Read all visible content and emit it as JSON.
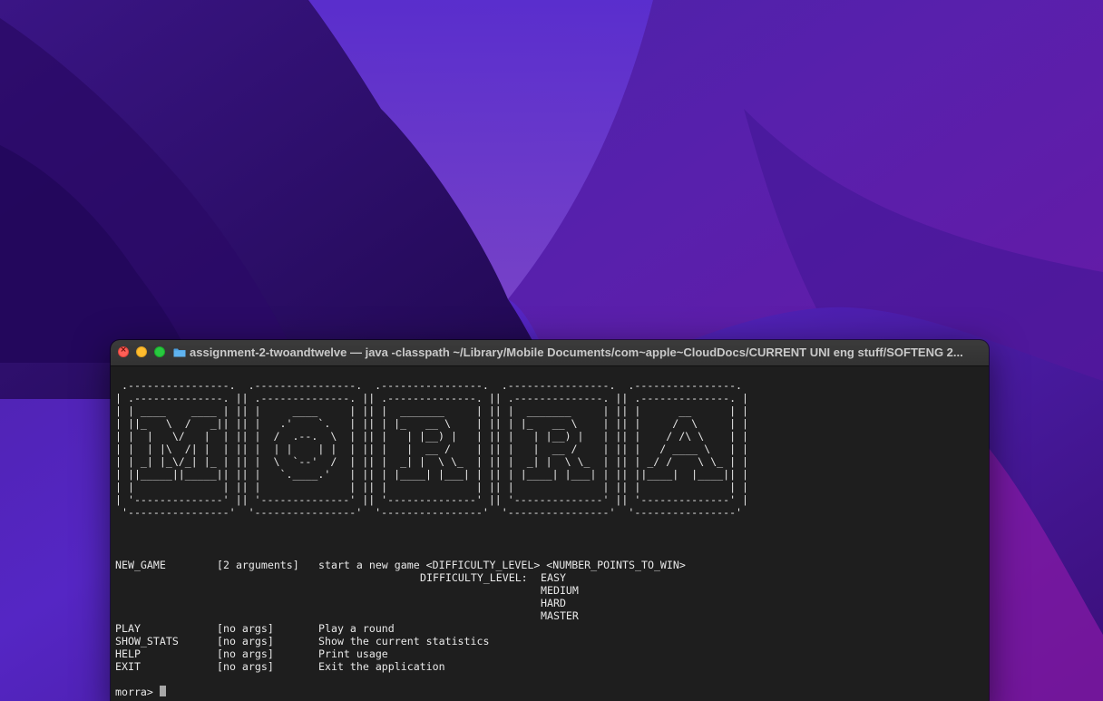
{
  "desktop": {
    "wallpaper": "macOS Monterey",
    "colors": {
      "base": "#3b0f7a",
      "light": "#6b32d8",
      "dark": "#1e0845",
      "accent": "#c44cc9"
    }
  },
  "window": {
    "title": "assignment-2-twoandtwelve — java -classpath ~/Library/Mobile Documents/com~apple~CloudDocs/CURRENT UNI eng stuff/SOFTENG 2...",
    "title_icon": "folder-icon",
    "controls": [
      "close-button",
      "minimize-button",
      "zoom-button"
    ]
  },
  "terminal": {
    "banner_ascii": [
      " .----------------.  .----------------.  .----------------.  .----------------.  .----------------.",
      "| .--------------. || .--------------. || .--------------. || .--------------. || .--------------. |",
      "| | ____    ____ | || |     ____     | || |  _______     | || |  _______     | || |      __      | |",
      "| ||_   \\  /   _|| || |   .'    `.   | || | |_   __ \\    | || | |_   __ \\    | || |     /  \\     | |",
      "| |  |   \\/   |  | || |  /  .--.  \\  | || |   | |__) |   | || |   | |__) |   | || |    / /\\ \\    | |",
      "| |  | |\\  /| |  | || |  | |    | |  | || |   |  __ /    | || |   |  __ /    | || |   / ____ \\   | |",
      "| | _| |_\\/_| |_ | || |  \\  `--'  /  | || |  _| |  \\ \\_  | || |  _| |  \\ \\_  | || | _/ /    \\ \\_ | |",
      "| ||_____||_____|| || |   `.____.'   | || | |____| |___| | || | |____| |___| | || ||____|  |____|| |",
      "| |              | || |              | || |              | || |              | || |              | |",
      "| '--------------' || '--------------' || '--------------' || '--------------' || '--------------' |",
      " '----------------'  '----------------'  '----------------'  '----------------'  '----------------'"
    ],
    "commands": [
      {
        "name": "NEW_GAME",
        "args": "[2 arguments]",
        "desc": "start a new game <DIFFICULTY_LEVEL> <NUMBER_POINTS_TO_WIN>"
      },
      {
        "name": "PLAY",
        "args": "[no args]",
        "desc": "Play a round"
      },
      {
        "name": "SHOW_STATS",
        "args": "[no args]",
        "desc": "Show the current statistics"
      },
      {
        "name": "HELP",
        "args": "[no args]",
        "desc": "Print usage"
      },
      {
        "name": "EXIT",
        "args": "[no args]",
        "desc": "Exit the application"
      }
    ],
    "difficulty_label": "DIFFICULTY_LEVEL:",
    "difficulty_levels": [
      "EASY",
      "MEDIUM",
      "HARD",
      "MASTER"
    ],
    "prompt": "morra> "
  }
}
